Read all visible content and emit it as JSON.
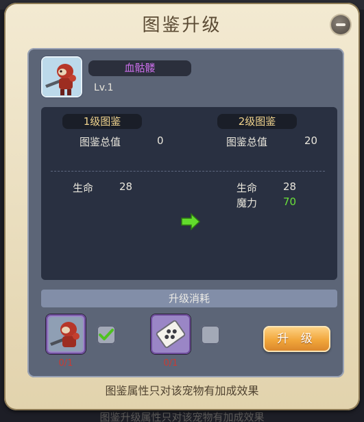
{
  "dialog": {
    "title": "图鉴升级"
  },
  "pet": {
    "name": "血骷髅",
    "level": "Lv.1"
  },
  "compare": {
    "current": {
      "tier": "1级图鉴",
      "total_label": "图鉴总值",
      "total_value": "0",
      "stats": [
        {
          "label": "生命",
          "value": "28"
        }
      ]
    },
    "next": {
      "tier": "2级图鉴",
      "total_label": "图鉴总值",
      "total_value": "20",
      "stats": [
        {
          "label": "生命",
          "value": "28"
        },
        {
          "label": "魔力",
          "value": "70"
        }
      ]
    }
  },
  "cost": {
    "header": "升级消耗",
    "items": [
      {
        "icon": "pet-card-icon",
        "count": "0/1",
        "checked": true
      },
      {
        "icon": "dice-icon",
        "count": "0/1",
        "checked": false
      }
    ],
    "upgrade_label": "升 级"
  },
  "footer": {
    "note": "图鉴属性只对该宠物有加成效果",
    "background_text": "图鉴升级属性只对该宠物有加成效果"
  },
  "colors": {
    "name": "#c96ee8",
    "tier": "#f1d48e",
    "bonus": "#6be23a",
    "count": "#c93a33",
    "button": "#f1a63b"
  }
}
